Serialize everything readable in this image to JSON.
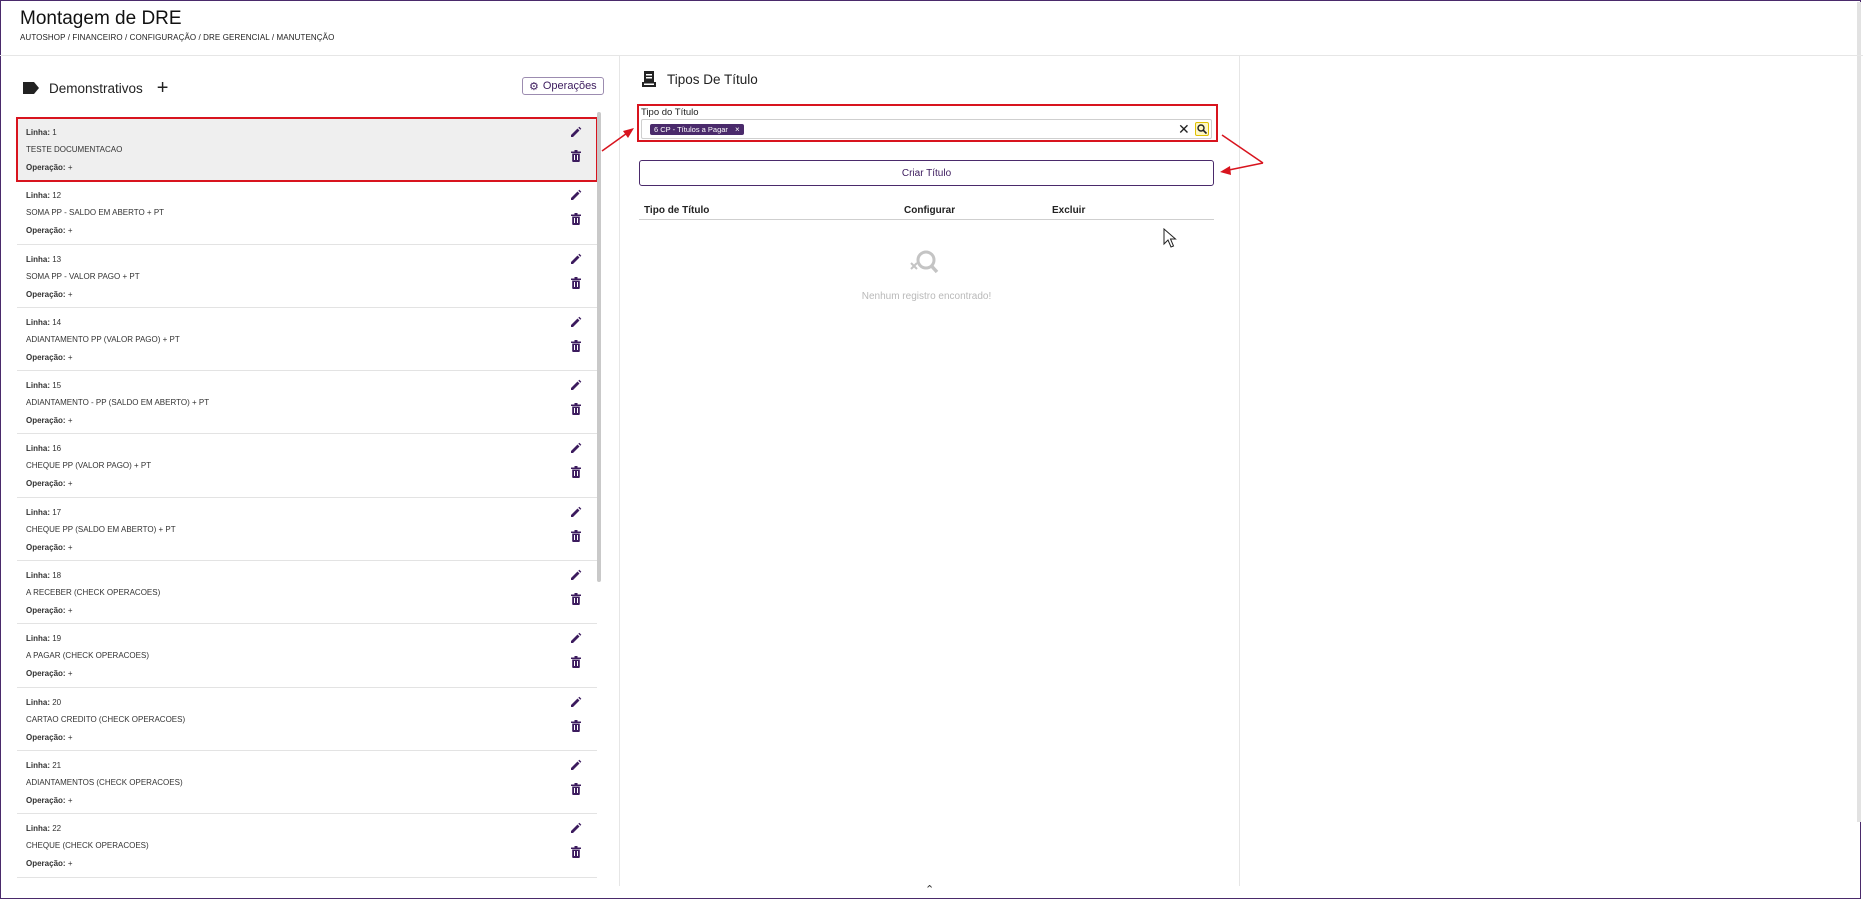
{
  "page": {
    "title": "Montagem de DRE",
    "breadcrumb": "AUTOSHOP / FINANCEIRO / CONFIGURAÇÃO / DRE GERENCIAL / MANUTENÇÃO"
  },
  "left": {
    "title": "Demonstrativos",
    "operations_label": "Operações",
    "line_label": "Linha:",
    "op_label": "Operação:",
    "items": [
      {
        "line": "1",
        "desc": "TESTE DOCUMENTACAO",
        "op": "+"
      },
      {
        "line": "12",
        "desc": "SOMA PP - SALDO EM ABERTO + PT",
        "op": "+"
      },
      {
        "line": "13",
        "desc": "SOMA PP - VALOR PAGO + PT",
        "op": "+"
      },
      {
        "line": "14",
        "desc": "ADIANTAMENTO PP (VALOR PAGO) + PT",
        "op": "+"
      },
      {
        "line": "15",
        "desc": "ADIANTAMENTO - PP (SALDO EM ABERTO) + PT",
        "op": "+"
      },
      {
        "line": "16",
        "desc": "CHEQUE PP (VALOR PAGO) + PT",
        "op": "+"
      },
      {
        "line": "17",
        "desc": "CHEQUE PP (SALDO EM ABERTO) + PT",
        "op": "+"
      },
      {
        "line": "18",
        "desc": "A RECEBER (CHECK OPERACOES)",
        "op": "+"
      },
      {
        "line": "19",
        "desc": "A PAGAR (CHECK OPERACOES)",
        "op": "+"
      },
      {
        "line": "20",
        "desc": "CARTAO CREDITO (CHECK OPERACOES)",
        "op": "+"
      },
      {
        "line": "21",
        "desc": "ADIANTAMENTOS (CHECK OPERACOES)",
        "op": "+"
      },
      {
        "line": "22",
        "desc": "CHEQUE (CHECK OPERACOES)",
        "op": "+"
      }
    ]
  },
  "mid": {
    "title": "Tipos De Título",
    "field_label": "Tipo do Título",
    "chip": "6 CP - Títulos a Pagar",
    "chip_close": "×",
    "clear": "✕",
    "create_button": "Criar Título",
    "columns": [
      "Tipo de Título",
      "Configurar",
      "Excluir"
    ],
    "empty_text": "Nenhum registro encontrado!"
  },
  "footer": {
    "chevron": "⌃"
  },
  "colors": {
    "accent": "#4a2a6b",
    "highlight": "#d8141e"
  }
}
